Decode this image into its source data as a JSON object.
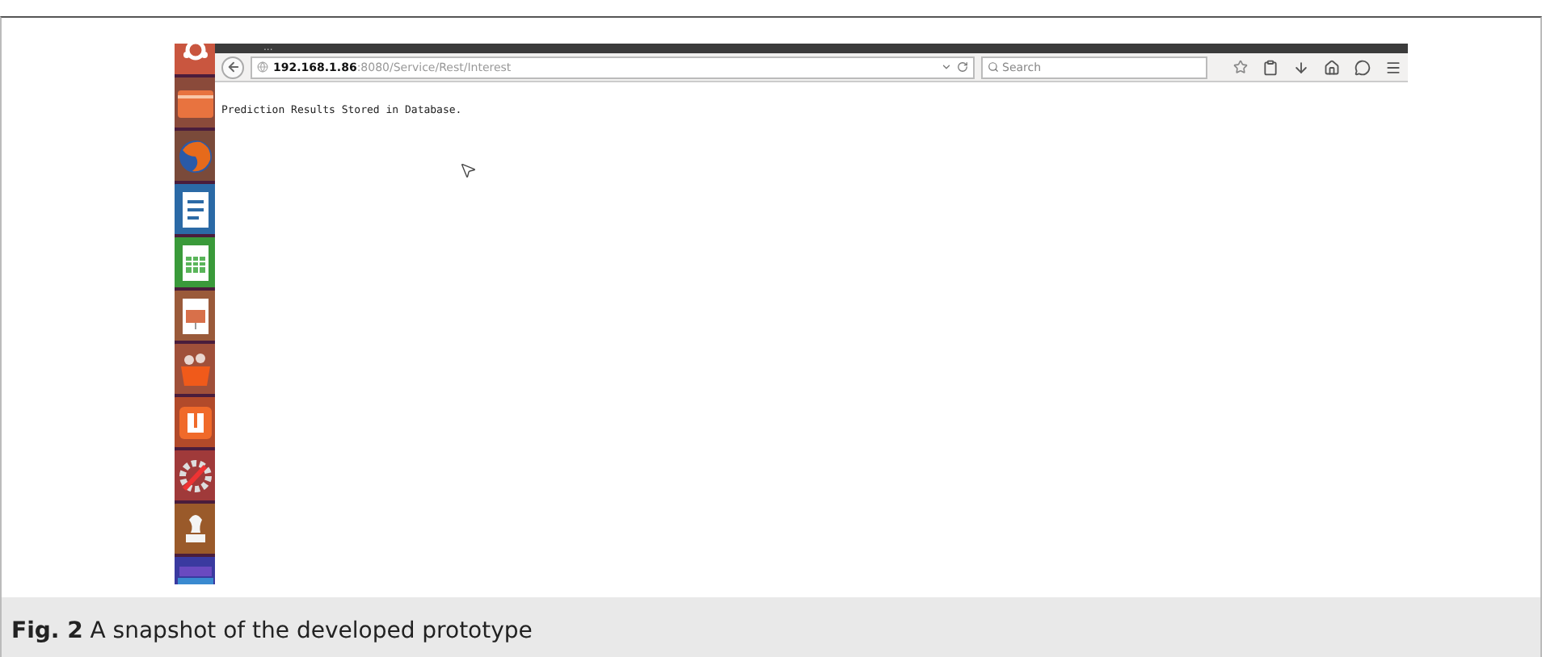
{
  "launcher": {
    "items": [
      {
        "kind": "ubuntu"
      },
      {
        "kind": "folder"
      },
      {
        "kind": "firefox"
      },
      {
        "kind": "writer"
      },
      {
        "kind": "calc"
      },
      {
        "kind": "impress"
      },
      {
        "kind": "store"
      },
      {
        "kind": "one"
      },
      {
        "kind": "settings"
      },
      {
        "kind": "chess"
      },
      {
        "kind": "stack"
      }
    ]
  },
  "browser": {
    "tab_dots": "...",
    "url_host": "192.168.1.86",
    "url_path": ":8080/Service/Rest/Interest",
    "search": {
      "placeholder": "Search"
    },
    "content": "Prediction Results Stored in Database."
  },
  "caption": "**Fig. 2** A snapshot of the developed prototype"
}
